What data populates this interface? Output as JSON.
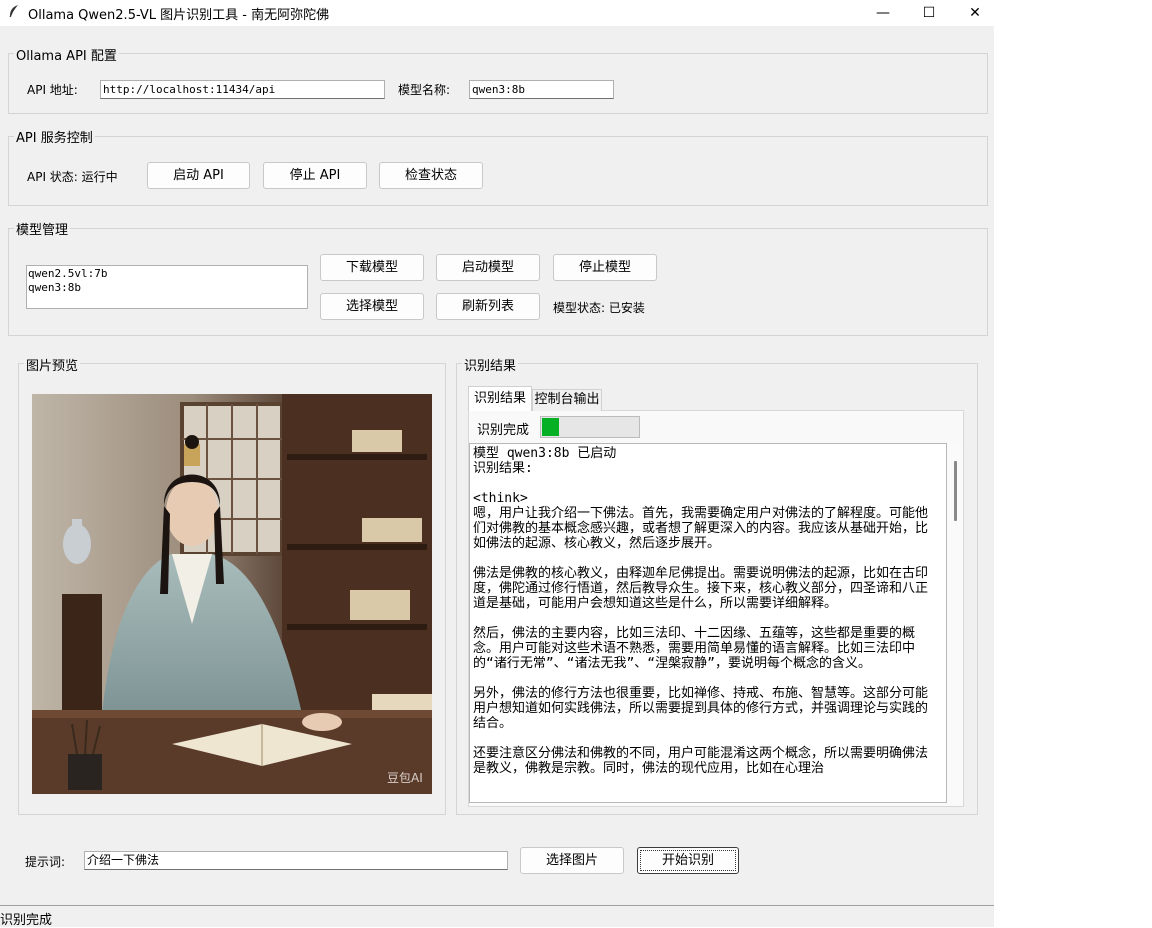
{
  "window": {
    "title": "Ollama Qwen2.5-VL 图片识别工具 - 南无阿弥陀佛",
    "icon": "feather-icon",
    "minimize_glyph": "—",
    "maximize_glyph": "☐",
    "close_glyph": "✕"
  },
  "api_config": {
    "label": "Ollama API 配置",
    "address_label": "API 地址:",
    "address_value": "http://localhost:11434/api",
    "model_label": "模型名称:",
    "model_value": "qwen3:8b"
  },
  "api_service": {
    "label": "API 服务控制",
    "status_text": "API 状态: 运行中",
    "start_button": "启动 API",
    "stop_button": "停止 API",
    "check_button": "检查状态"
  },
  "model_mgmt": {
    "label": "模型管理",
    "models": [
      "qwen2.5vl:7b",
      "qwen3:8b"
    ],
    "download_button": "下载模型",
    "start_button": "启动模型",
    "stop_button": "停止模型",
    "select_button": "选择模型",
    "refresh_button": "刷新列表",
    "status_text": "模型状态: 已安装"
  },
  "preview": {
    "label": "图片预览",
    "watermark": "豆包AI"
  },
  "result": {
    "label": "识别结果",
    "tabs": [
      "识别结果",
      "控制台输出"
    ],
    "progress_label": "识别完成",
    "progress_fraction": 0.17,
    "text": "模型 qwen3:8b 已启动\n识别结果:\n\n<think>\n嗯，用户让我介绍一下佛法。首先，我需要确定用户对佛法的了解程度。可能他们对佛教的基本概念感兴趣，或者想了解更深入的内容。我应该从基础开始，比如佛法的起源、核心教义，然后逐步展开。\n\n佛法是佛教的核心教义，由释迦牟尼佛提出。需要说明佛法的起源，比如在古印度，佛陀通过修行悟道，然后教导众生。接下来，核心教义部分，四圣谛和八正道是基础，可能用户会想知道这些是什么，所以需要详细解释。\n\n然后，佛法的主要内容，比如三法印、十二因缘、五蕴等，这些都是重要的概念。用户可能对这些术语不熟悉，需要用简单易懂的语言解释。比如三法印中的“诸行无常”、“诸法无我”、“涅槃寂静”，要说明每个概念的含义。\n\n另外，佛法的修行方法也很重要，比如禅修、持戒、布施、智慧等。这部分可能用户想知道如何实践佛法，所以需要提到具体的修行方式，并强调理论与实践的结合。\n\n还要注意区分佛法和佛教的不同，用户可能混淆这两个概念，所以需要明确佛法是教义，佛教是宗教。同时，佛法的现代应用，比如在心理治"
  },
  "prompt": {
    "label": "提示词:",
    "value": "介绍一下佛法",
    "select_image_button": "选择图片",
    "start_button": "开始识别"
  },
  "status_bar": {
    "text": "识别完成"
  }
}
